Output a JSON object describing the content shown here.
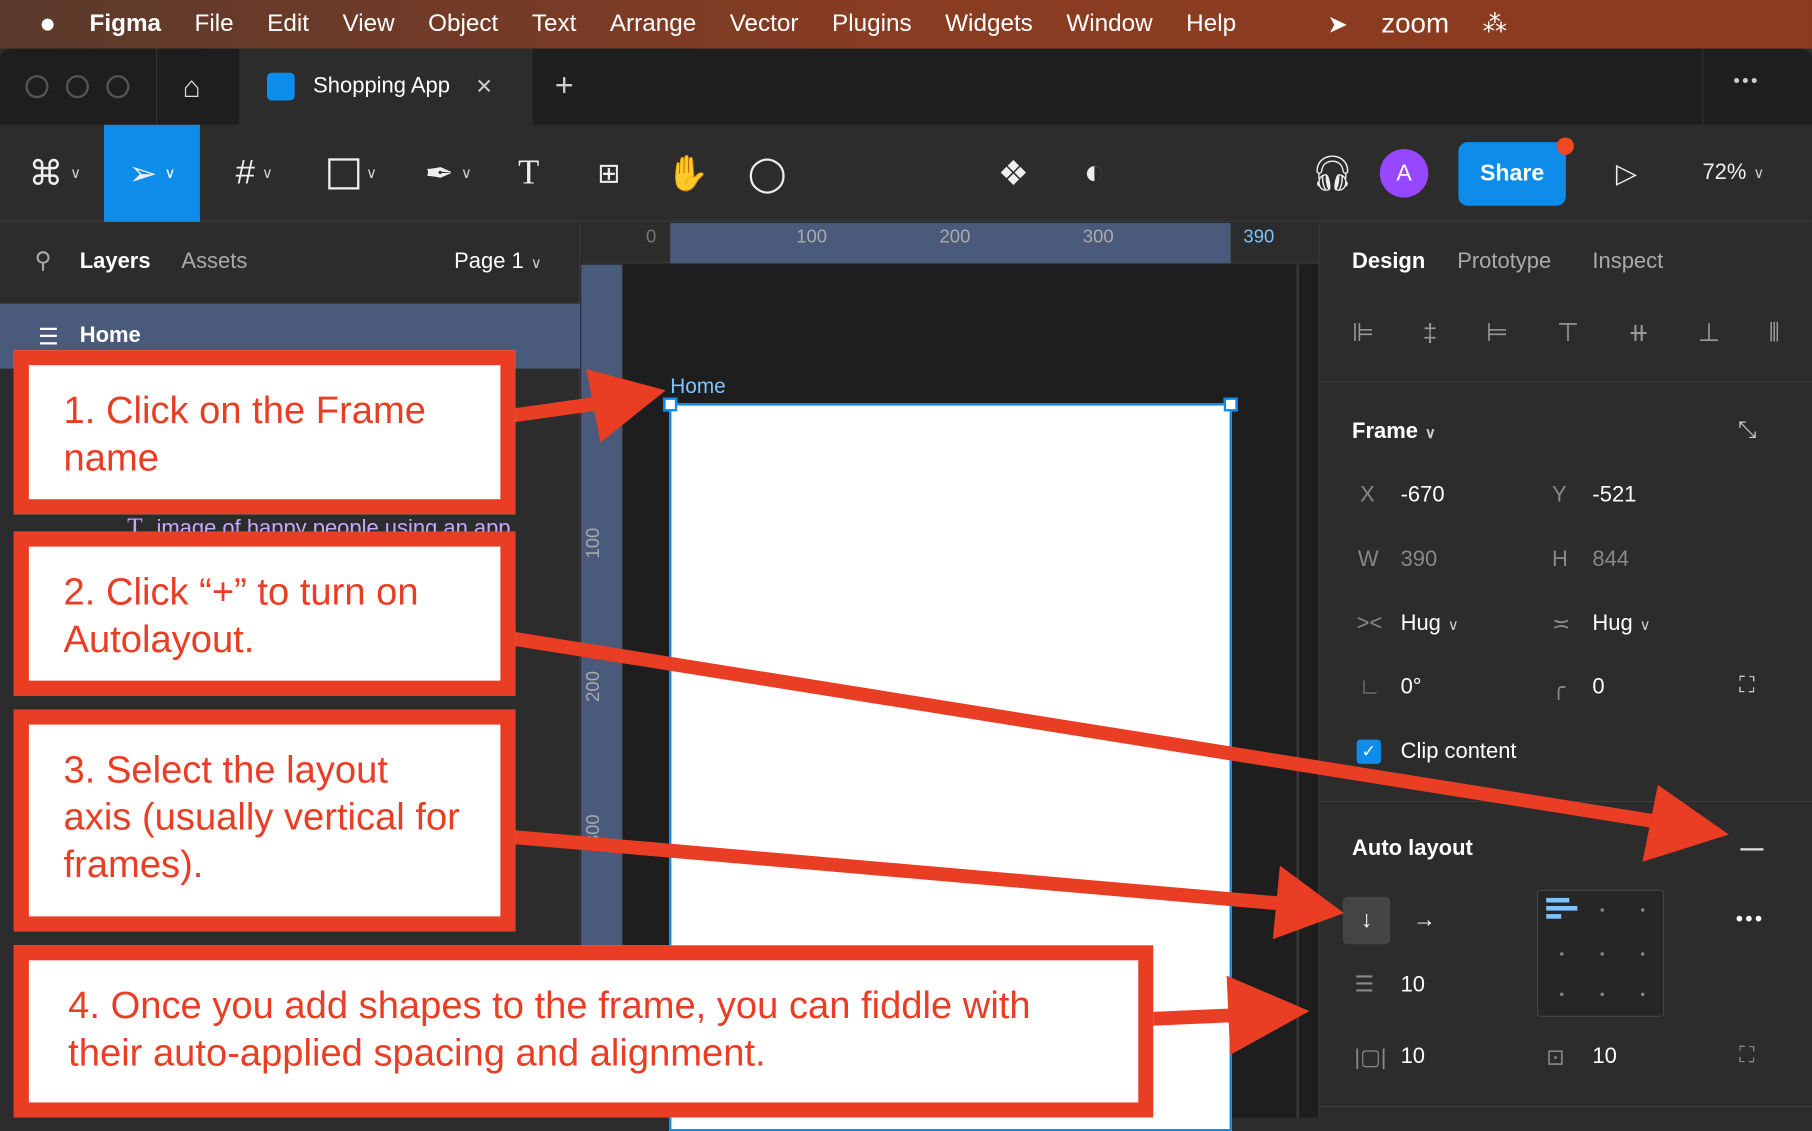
{
  "menubar": {
    "app": "Figma",
    "items": [
      "File",
      "Edit",
      "View",
      "Object",
      "Text",
      "Arrange",
      "Vector",
      "Plugins",
      "Widgets",
      "Window",
      "Help"
    ],
    "zoom_label": "zoom"
  },
  "tabbar": {
    "tab_title": "Shopping App",
    "close": "✕",
    "new_tab": "+",
    "more": "•••"
  },
  "toolbar": {
    "avatar": "A",
    "share": "Share",
    "zoom": "72%"
  },
  "left_panel": {
    "tabs": [
      "Layers",
      "Assets"
    ],
    "page": "Page 1",
    "layers": [
      {
        "name": "Home",
        "type": "frame"
      },
      {
        "name": "image of happy people using an app",
        "type": "text"
      }
    ]
  },
  "canvas": {
    "frame_label": "Home",
    "ruler_x": [
      "0",
      "100",
      "200",
      "300",
      "390"
    ],
    "ruler_y": [
      "100",
      "200",
      "300"
    ]
  },
  "right_panel": {
    "tabs": [
      "Design",
      "Prototype",
      "Inspect"
    ],
    "frame": {
      "title": "Frame",
      "x_label": "X",
      "x": "-670",
      "y_label": "Y",
      "y": "-521",
      "w_label": "W",
      "w": "390",
      "h_label": "H",
      "h": "844",
      "hug_w": "Hug",
      "hug_h": "Hug",
      "rotation": "0°",
      "radius": "0",
      "clip_label": "Clip content",
      "clip_checked": true
    },
    "auto_layout": {
      "title": "Auto layout",
      "direction": "vertical",
      "spacing": "10",
      "padding_h": "10",
      "padding_v": "10"
    }
  },
  "callouts": [
    "1. Click on the Frame name",
    "2. Click “+” to turn on Autolayout.",
    "3. Select the layout axis (usually vertical for frames).",
    "4. Once you add shapes to the frame, you can fiddle with their auto-applied spacing and alignment."
  ],
  "colors": {
    "accent": "#0d8ce9",
    "annotation": "#e93d24",
    "avatar": "#9747ff",
    "selection": "#4a5a7a"
  }
}
